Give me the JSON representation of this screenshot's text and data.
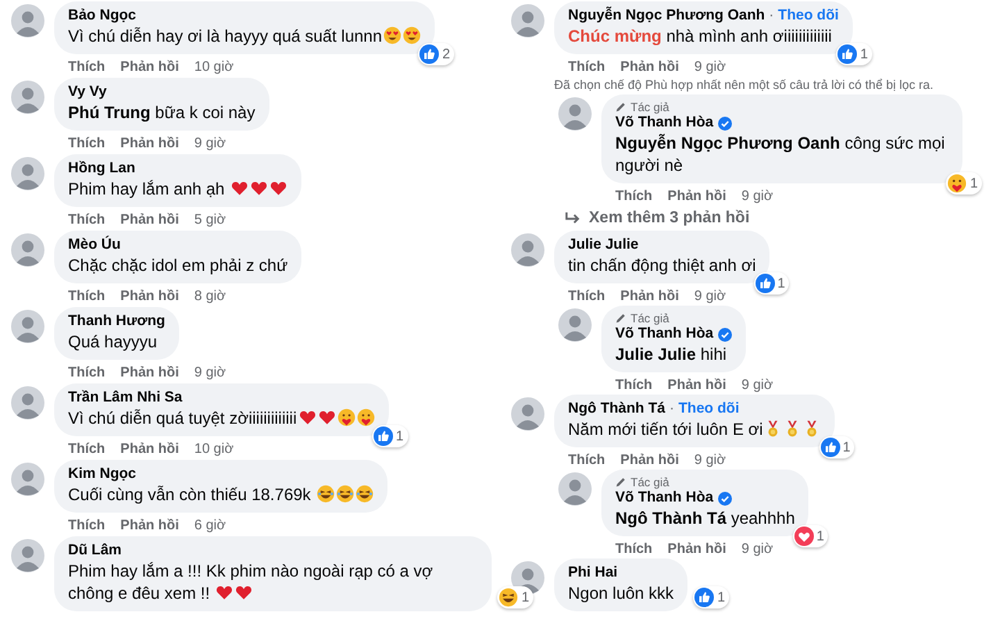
{
  "columns": [
    {
      "items": [
        {
          "kind": "comment",
          "author": "Bảo Ngọc",
          "parts": [
            {
              "kind": "plain",
              "text": "Vì chú diễn hay ơi là hayyy quá suất lunnn"
            }
          ],
          "emojis": [
            {
              "kind": "heart-eyes"
            },
            {
              "kind": "heart-eyes"
            }
          ],
          "reaction": {
            "kind": "like",
            "count": "2"
          },
          "actions": {
            "like": "Thích",
            "reply": "Phản hồi",
            "time": "10 giờ"
          }
        },
        {
          "kind": "comment",
          "author": "Vy Vy",
          "parts": [
            {
              "kind": "mention",
              "text": "Phú Trung"
            },
            {
              "kind": "plain",
              "text": " bữa k coi này"
            }
          ],
          "actions": {
            "like": "Thích",
            "reply": "Phản hồi",
            "time": "9 giờ"
          }
        },
        {
          "kind": "comment",
          "author": "Hồng Lan",
          "parts": [
            {
              "kind": "plain",
              "text": "Phim hay lắm anh ạh "
            }
          ],
          "emojis": [
            {
              "kind": "heart"
            },
            {
              "kind": "heart"
            },
            {
              "kind": "heart"
            }
          ],
          "actions": {
            "like": "Thích",
            "reply": "Phản hồi",
            "time": "5 giờ"
          }
        },
        {
          "kind": "comment",
          "author": "Mèo Úu",
          "parts": [
            {
              "kind": "plain",
              "text": "Chặc chặc idol em phải z chứ"
            }
          ],
          "actions": {
            "like": "Thích",
            "reply": "Phản hồi",
            "time": "8 giờ"
          }
        },
        {
          "kind": "comment",
          "author": "Thanh Hương",
          "parts": [
            {
              "kind": "plain",
              "text": "Quá hayyyu"
            }
          ],
          "actions": {
            "like": "Thích",
            "reply": "Phản hồi",
            "time": "9 giờ"
          }
        },
        {
          "kind": "comment",
          "author": "Trần Lâm Nhi Sa",
          "parts": [
            {
              "kind": "plain",
              "text": "Vì chú diễn quá tuyệt zờiiiiiiiiiiiii"
            }
          ],
          "emojis": [
            {
              "kind": "heart"
            },
            {
              "kind": "heart"
            },
            {
              "kind": "care"
            },
            {
              "kind": "care"
            }
          ],
          "reaction": {
            "kind": "like",
            "count": "1"
          },
          "actions": {
            "like": "Thích",
            "reply": "Phản hồi",
            "time": "10 giờ"
          }
        },
        {
          "kind": "comment",
          "author": "Kim Ngọc",
          "parts": [
            {
              "kind": "plain",
              "text": "Cuối cùng vẫn còn thiếu 18.769k "
            }
          ],
          "emojis": [
            {
              "kind": "haha"
            },
            {
              "kind": "haha"
            },
            {
              "kind": "haha"
            }
          ],
          "actions": {
            "like": "Thích",
            "reply": "Phản hồi",
            "time": "6 giờ"
          }
        },
        {
          "kind": "comment",
          "author": "Dũ Lâm",
          "parts": [
            {
              "kind": "plain",
              "text": "Phim hay lắm a !!! Kk phim nào ngoài rạp có a vợ chông e đêu xem !! "
            }
          ],
          "emojis": [
            {
              "kind": "heart"
            },
            {
              "kind": "heart"
            }
          ],
          "reaction": {
            "kind": "haha",
            "count": "1"
          }
        }
      ]
    },
    {
      "items": [
        {
          "kind": "comment",
          "author": "Nguyễn Ngọc Phương Oanh",
          "separator": "·",
          "follow": "Theo dõi",
          "parts": [
            {
              "kind": "highlight",
              "text": "Chúc mừng"
            },
            {
              "kind": "plain",
              "text": " nhà mình anh ơiiiiiiiiiiiii"
            }
          ],
          "reaction": {
            "kind": "like",
            "count": "1"
          },
          "actions": {
            "like": "Thích",
            "reply": "Phản hồi",
            "time": "9 giờ"
          }
        },
        {
          "kind": "note",
          "text": "Đã chọn chế độ Phù hợp nhất nên một số câu trả lời có thể bị lọc ra."
        },
        {
          "kind": "reply",
          "tag": "Tác giả",
          "author": "Võ Thanh Hòa",
          "verified": true,
          "parts": [
            {
              "kind": "mention",
              "text": "Nguyễn Ngọc Phương Oanh"
            },
            {
              "kind": "plain",
              "text": " công sức mọi người nè"
            }
          ],
          "reaction": {
            "kind": "care",
            "count": "1"
          },
          "actions": {
            "like": "Thích",
            "reply": "Phản hồi",
            "time": "9 giờ"
          }
        },
        {
          "kind": "more",
          "text": "Xem thêm 3 phản hồi"
        },
        {
          "kind": "comment",
          "author": "Julie Julie",
          "parts": [
            {
              "kind": "plain",
              "text": "tin chấn động thiệt anh ơi"
            }
          ],
          "reaction": {
            "kind": "like",
            "count": "1"
          },
          "actions": {
            "like": "Thích",
            "reply": "Phản hồi",
            "time": "9 giờ"
          }
        },
        {
          "kind": "reply",
          "tag": "Tác giả",
          "author": "Võ Thanh Hòa",
          "verified": true,
          "parts": [
            {
              "kind": "mention",
              "text": "Julie Julie"
            },
            {
              "kind": "plain",
              "text": " hihi"
            }
          ],
          "actions": {
            "like": "Thích",
            "reply": "Phản hồi",
            "time": "9 giờ"
          }
        },
        {
          "kind": "comment",
          "author": "Ngô Thành Tá",
          "separator": "·",
          "follow": "Theo dõi",
          "parts": [
            {
              "kind": "plain",
              "text": "Năm mới tiến tới luôn E ơi"
            }
          ],
          "emojis": [
            {
              "kind": "medal"
            },
            {
              "kind": "medal"
            },
            {
              "kind": "medal"
            }
          ],
          "reaction": {
            "kind": "like",
            "count": "1"
          },
          "actions": {
            "like": "Thích",
            "reply": "Phản hồi",
            "time": "9 giờ"
          }
        },
        {
          "kind": "reply",
          "tag": "Tác giả",
          "author": "Võ Thanh Hòa",
          "verified": true,
          "parts": [
            {
              "kind": "mention",
              "text": "Ngô Thành Tá"
            },
            {
              "kind": "plain",
              "text": " yeahhhh"
            }
          ],
          "reaction": {
            "kind": "love",
            "count": "1"
          },
          "actions": {
            "like": "Thích",
            "reply": "Phản hồi",
            "time": "9 giờ"
          }
        },
        {
          "kind": "comment",
          "author": "Phi Hai",
          "parts": [
            {
              "kind": "plain",
              "text": "Ngon luôn kkk"
            }
          ],
          "reaction": {
            "kind": "like",
            "count": "1"
          }
        }
      ]
    }
  ]
}
